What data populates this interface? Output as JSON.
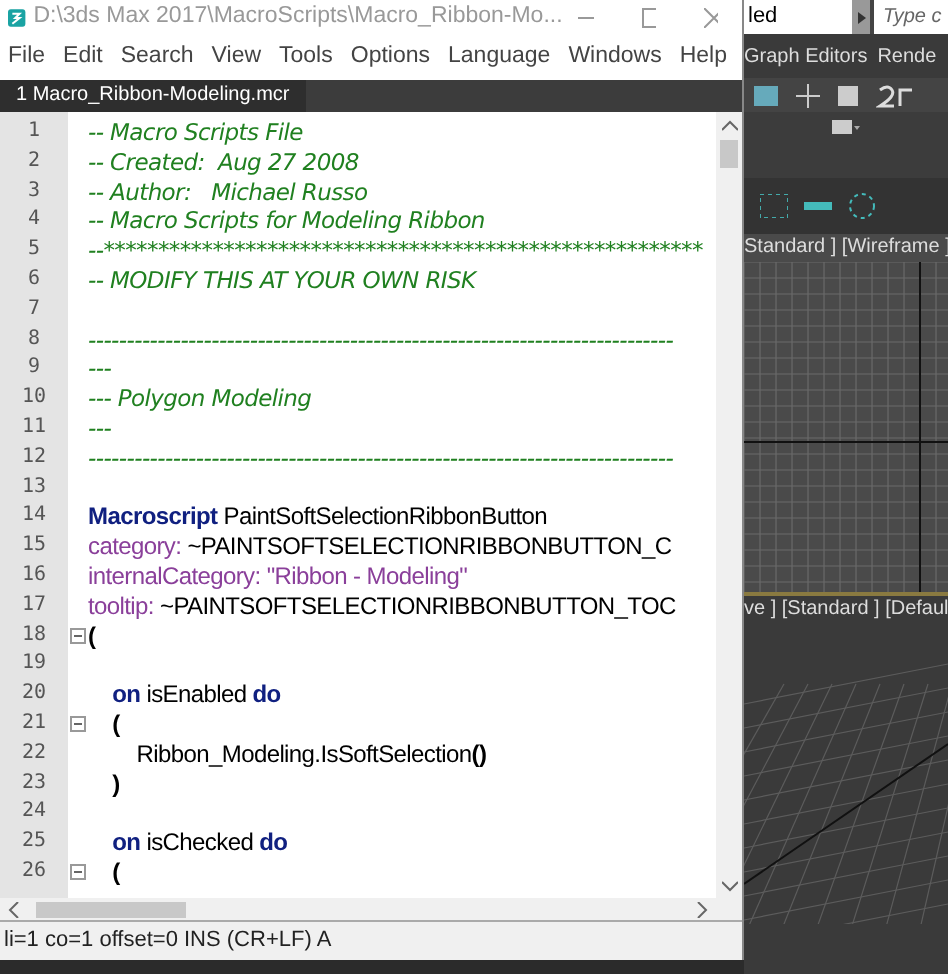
{
  "editor": {
    "title": "D:\\3ds Max 2017\\MacroScripts\\Macro_Ribbon-Mo...",
    "menu": [
      "File",
      "Edit",
      "Search",
      "View",
      "Tools",
      "Options",
      "Language",
      "Windows",
      "Help"
    ],
    "tabs": [
      {
        "label": "1 Macro_Ribbon-Modeling.mcr",
        "selected": true
      }
    ],
    "lines": [
      {
        "number": "1",
        "fold": false,
        "segments": [
          {
            "kind": "comment",
            "text": "-- Macro Scripts File"
          }
        ]
      },
      {
        "number": "2",
        "fold": false,
        "segments": [
          {
            "kind": "comment",
            "text": "-- Created:  Aug 27 2008"
          }
        ]
      },
      {
        "number": "3",
        "fold": false,
        "segments": [
          {
            "kind": "comment",
            "text": "-- Author:   Michael Russo"
          }
        ]
      },
      {
        "number": "4",
        "fold": false,
        "segments": [
          {
            "kind": "comment",
            "text": "-- Macro Scripts for Modeling Ribbon"
          }
        ]
      },
      {
        "number": "5",
        "fold": false,
        "segments": [
          {
            "kind": "comment",
            "text": "--*******************************************************"
          }
        ]
      },
      {
        "number": "6",
        "fold": false,
        "segments": [
          {
            "kind": "comment",
            "text": "-- MODIFY THIS AT YOUR OWN RISK"
          }
        ]
      },
      {
        "number": "7",
        "fold": false
      },
      {
        "number": "8",
        "fold": false,
        "segments": [
          {
            "kind": "comment",
            "text": "----------------------------------------------------------------------------"
          }
        ]
      },
      {
        "number": "9",
        "fold": false,
        "segments": [
          {
            "kind": "comment",
            "text": "---"
          }
        ]
      },
      {
        "number": "10",
        "fold": false,
        "segments": [
          {
            "kind": "comment",
            "text": "--- Polygon Modeling"
          }
        ]
      },
      {
        "number": "11",
        "fold": false,
        "segments": [
          {
            "kind": "comment",
            "text": "---"
          }
        ]
      },
      {
        "number": "12",
        "fold": false,
        "segments": [
          {
            "kind": "comment",
            "text": "----------------------------------------------------------------------------"
          }
        ]
      },
      {
        "number": "13",
        "fold": false
      },
      {
        "number": "14",
        "fold": false,
        "segments": [
          {
            "kind": "keyword",
            "text": "Macroscript"
          },
          {
            "kind": "plain",
            "text": " PaintSoftSelectionRibbonButton"
          }
        ]
      },
      {
        "number": "15",
        "fold": false,
        "segments": [
          {
            "kind": "property",
            "text": "category:"
          },
          {
            "kind": "plain",
            "text": " ~PAINTSOFTSELECTIONRIBBONBUTTON_C"
          }
        ]
      },
      {
        "number": "16",
        "fold": false,
        "segments": [
          {
            "kind": "property",
            "text": "internalCategory:"
          },
          {
            "kind": "string",
            "text": " \"Ribbon - Modeling\""
          }
        ]
      },
      {
        "number": "17",
        "fold": false,
        "segments": [
          {
            "kind": "property",
            "text": "tooltip:"
          },
          {
            "kind": "plain",
            "text": " ~PAINTSOFTSELECTIONRIBBONBUTTON_TOC"
          }
        ]
      },
      {
        "number": "18",
        "fold": true,
        "segments": [
          {
            "kind": "bracket",
            "text": "("
          }
        ]
      },
      {
        "number": "19",
        "fold": false
      },
      {
        "number": "20",
        "fold": false,
        "segments": [
          {
            "kind": "keyword",
            "text": "    on"
          },
          {
            "kind": "plain",
            "text": " isEnabled "
          },
          {
            "kind": "keyword",
            "text": "do"
          }
        ]
      },
      {
        "number": "21",
        "fold": true,
        "segments": [
          {
            "kind": "bracket",
            "text": "    ("
          }
        ]
      },
      {
        "number": "22",
        "fold": false,
        "segments": [
          {
            "kind": "plain",
            "text": "        Ribbon_Modeling.IsSoftSelection"
          },
          {
            "kind": "bracket",
            "text": "()"
          }
        ]
      },
      {
        "number": "23",
        "fold": false,
        "segments": [
          {
            "kind": "bracket",
            "text": "    )"
          }
        ]
      },
      {
        "number": "24",
        "fold": false
      },
      {
        "number": "25",
        "fold": false,
        "segments": [
          {
            "kind": "keyword",
            "text": "    on"
          },
          {
            "kind": "plain",
            "text": " isChecked "
          },
          {
            "kind": "keyword",
            "text": "do"
          }
        ]
      },
      {
        "number": "26",
        "fold": true,
        "segments": [
          {
            "kind": "bracket",
            "text": "    ("
          }
        ]
      }
    ],
    "status_bar": "li=1 co=1 offset=0 INS (CR+LF) A"
  },
  "background_app": {
    "scene_field": "led",
    "search": {
      "placeholder": "Type c"
    },
    "menu": [
      "Graph Editors",
      "Rende"
    ],
    "viewports": [
      {
        "label": "Standard ] [Wireframe ]",
        "kind": "ortho"
      },
      {
        "label": "ve ] [Standard ] [Defaul",
        "kind": "perspective"
      }
    ]
  }
}
